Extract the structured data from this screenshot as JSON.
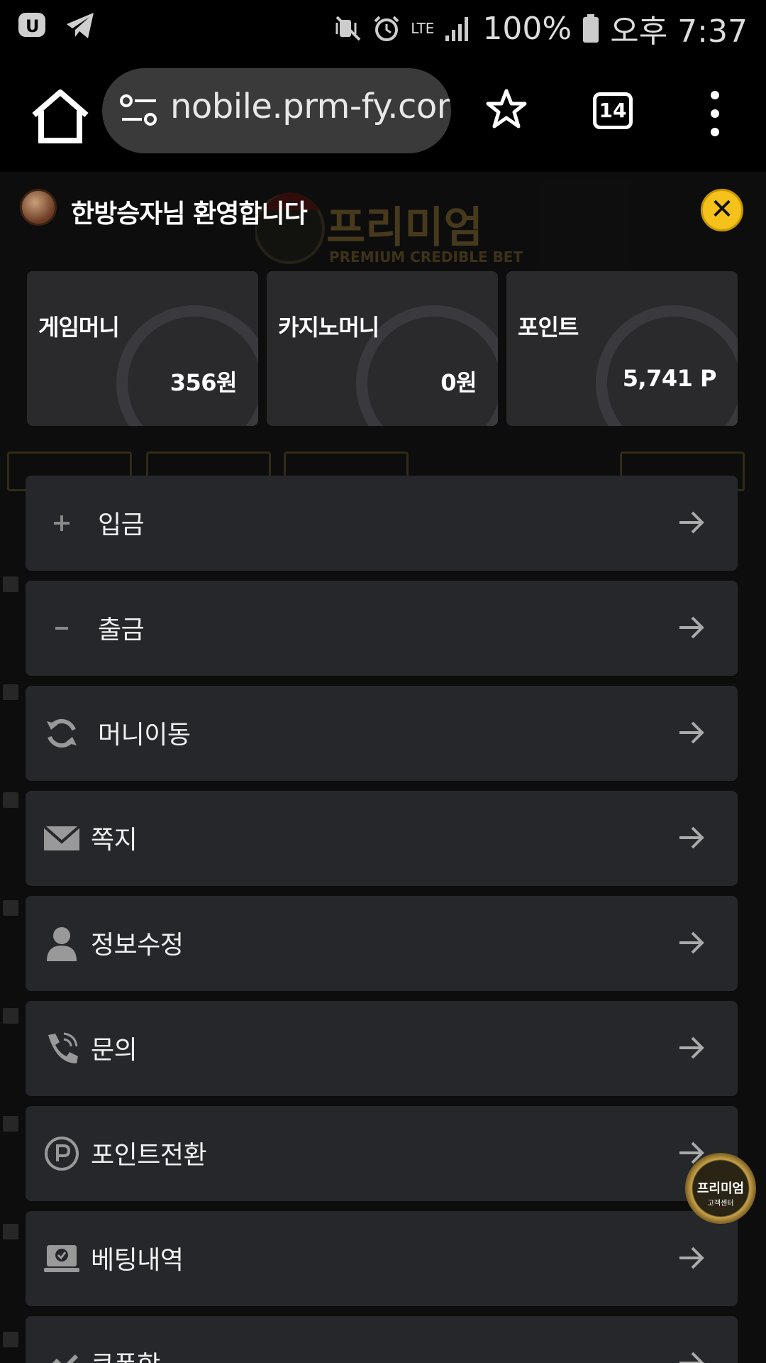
{
  "status_bar": {
    "network": "LTE",
    "battery": "100%",
    "time": "오후 7:37"
  },
  "browser": {
    "url": "nobile.prm-fy.com",
    "tab_count": "14"
  },
  "background_page": {
    "logo_text": "프리미엄",
    "logo_sub": "PREMIUM CREDIBLE BET"
  },
  "menu": {
    "welcome": "한방승자님 환영합니다",
    "close_label": "✕",
    "balances": [
      {
        "label": "게임머니",
        "value": "356원",
        "icon": "soccer-ball-icon"
      },
      {
        "label": "카지노머니",
        "value": "0원",
        "icon": "casino-chip-icon"
      },
      {
        "label": "포인트",
        "value": "5,741 P",
        "icon": "point-coin-icon"
      }
    ],
    "items": [
      {
        "label": "입금",
        "icon": "plus-icon"
      },
      {
        "label": "출금",
        "icon": "minus-icon"
      },
      {
        "label": "머니이동",
        "icon": "refresh-icon"
      },
      {
        "label": "쪽지",
        "icon": "envelope-icon"
      },
      {
        "label": "정보수정",
        "icon": "user-icon"
      },
      {
        "label": "문의",
        "icon": "phone-icon"
      },
      {
        "label": "포인트전환",
        "icon": "point-icon"
      },
      {
        "label": "베팅내역",
        "icon": "laptop-check-icon"
      },
      {
        "label": "쿠폰함",
        "icon": "coupon-icon"
      }
    ]
  },
  "cs_badge": {
    "title": "프리미엄",
    "subtitle": "고객센터"
  },
  "colors": {
    "accent_gold": "#f4c21b",
    "menu_item_bg": "#26272b",
    "card_bg": "#2c2c30"
  }
}
